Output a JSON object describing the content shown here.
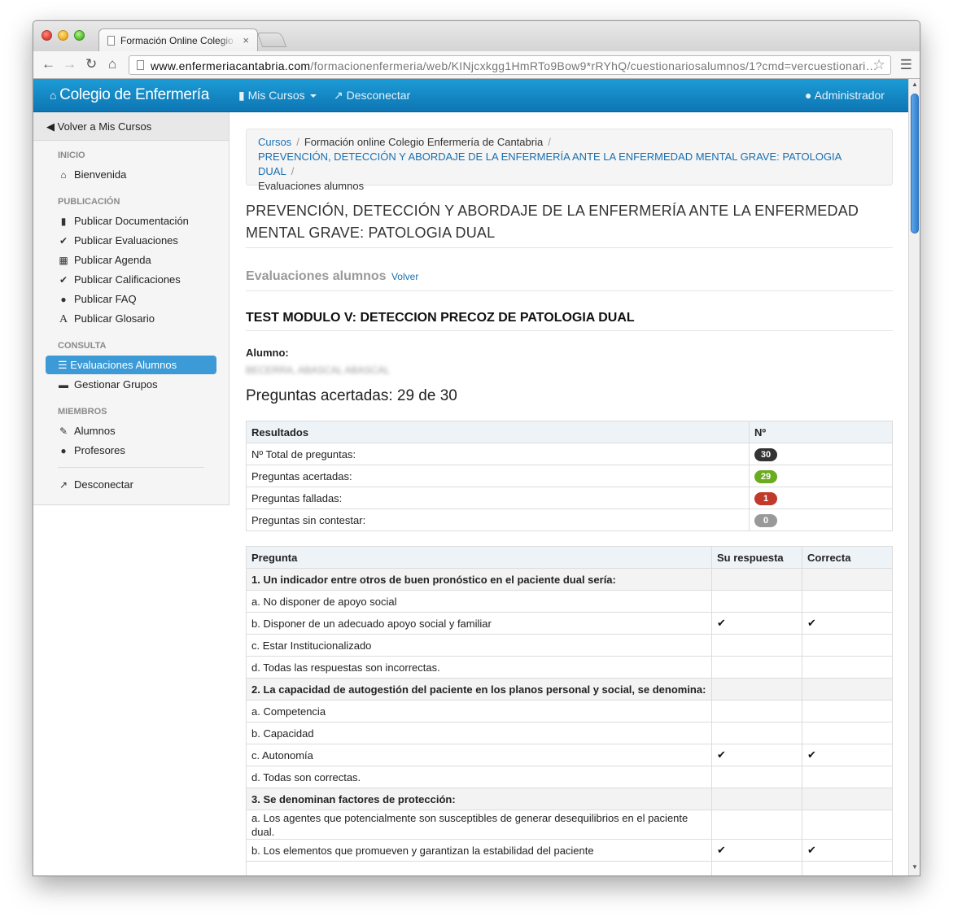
{
  "browser": {
    "tab_title": "Formación Online Colegio de Enfermería",
    "tab_close": "×",
    "url_domain": "www.enfermeriacantabria.com",
    "url_path": "/formacionenfermeria/web/KINjcxkgg1HmRTo9Bow9*rRYhQ/cuestionariosalumnos/1?cmd=vercuestionari…"
  },
  "navbar": {
    "brand": "Colegio de Enfermería",
    "mis_cursos": "Mis Cursos",
    "desconectar": "Desconectar",
    "admin": "Administrador"
  },
  "sidebar": {
    "back": "Volver a Mis Cursos",
    "sections": {
      "inicio": "INICIO",
      "publicacion": "PUBLICACIÓN",
      "consulta": "CONSULTA",
      "miembros": "MIEMBROS"
    },
    "items": {
      "bienvenida": "Bienvenida",
      "documentacion": "Publicar Documentación",
      "evaluaciones": "Publicar Evaluaciones",
      "agenda": "Publicar Agenda",
      "calificaciones": "Publicar Calificaciones",
      "faq": "Publicar FAQ",
      "glosario": "Publicar Glosario",
      "evaluaciones_alumnos": "Evaluaciones Alumnos",
      "grupos": "Gestionar Grupos",
      "alumnos": "Alumnos",
      "profesores": "Profesores",
      "desconectar": "Desconectar"
    }
  },
  "breadcrumb": {
    "cursos": "Cursos",
    "formacion": "Formación online Colegio Enfermería de Cantabria",
    "curso": "PREVENCIÓN, DETECCIÓN Y ABORDAJE DE LA ENFERMERÍA ANTE LA ENFERMEDAD MENTAL GRAVE: PATOLOGIA DUAL",
    "actual": "Evaluaciones alumnos",
    "separator": "/"
  },
  "page": {
    "course_title": "PREVENCIÓN, DETECCIÓN Y ABORDAJE DE LA ENFERMERÍA ANTE LA ENFERMEDAD MENTAL GRAVE: PATOLOGIA DUAL",
    "section_title": "Evaluaciones alumnos",
    "volver": "Volver",
    "test_title": "TEST MODULO V: DETECCION PRECOZ DE PATOLOGIA DUAL",
    "alumno_label": "Alumno:",
    "alumno_name": "BECERRA, ABASCAL ABASCAL",
    "score": "Preguntas acertadas: 29 de 30"
  },
  "results": {
    "header_label": "Resultados",
    "header_num": "Nº",
    "rows": [
      {
        "label": "Nº Total de preguntas:",
        "value": "30",
        "color": "#333333"
      },
      {
        "label": "Preguntas acertadas:",
        "value": "29",
        "color": "#6aab1f"
      },
      {
        "label": "Preguntas falladas:",
        "value": "1",
        "color": "#c0392b"
      },
      {
        "label": "Preguntas sin contestar:",
        "value": "0",
        "color": "#999999"
      }
    ]
  },
  "questions": {
    "headers": {
      "pregunta": "Pregunta",
      "respuesta": "Su respuesta",
      "correcta": "Correcta"
    },
    "check_icon": "check-icon",
    "items": [
      {
        "title": "1. Un indicador entre otros de buen pronóstico en el paciente dual sería:",
        "options": [
          {
            "text": "a. No disponer de apoyo social",
            "su": "",
            "ok": ""
          },
          {
            "text": "b. Disponer de un adecuado apoyo social y familiar",
            "su": "✔",
            "ok": "✔"
          },
          {
            "text": "c. Estar Institucionalizado",
            "su": "",
            "ok": ""
          },
          {
            "text": "d. Todas las respuestas son incorrectas.",
            "su": "",
            "ok": ""
          }
        ]
      },
      {
        "title": "2. La capacidad de autogestión del paciente en los planos personal y social, se denomina:",
        "options": [
          {
            "text": "a. Competencia",
            "su": "",
            "ok": ""
          },
          {
            "text": "b. Capacidad",
            "su": "",
            "ok": ""
          },
          {
            "text": "c. Autonomía",
            "su": "✔",
            "ok": "✔"
          },
          {
            "text": "d. Todas son correctas.",
            "su": "",
            "ok": ""
          }
        ]
      },
      {
        "title": "3. Se denominan factores de protección:",
        "options": [
          {
            "text": "a. Los agentes que potencialmente son susceptibles de generar desequilibrios en el paciente dual.",
            "su": "",
            "ok": ""
          },
          {
            "text": "b. Los elementos que promueven y garantizan la estabilidad del paciente",
            "su": "✔",
            "ok": "✔"
          }
        ]
      }
    ]
  }
}
